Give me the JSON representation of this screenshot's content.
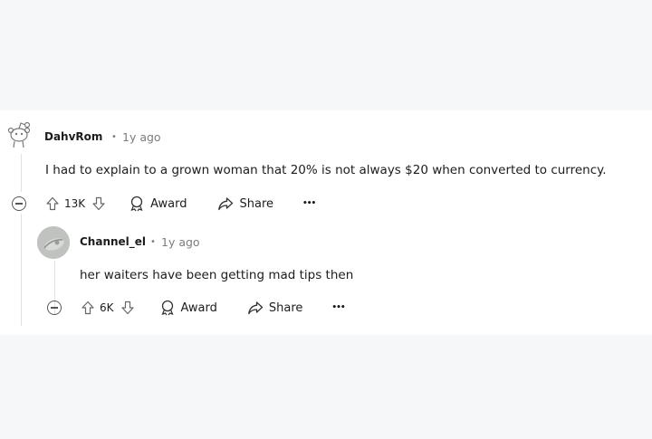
{
  "comment": {
    "username": "DahvRom",
    "separator": "•",
    "time": "1y ago",
    "text": "I had to explain to a grown woman that 20% is not always $20 when converted to currency.",
    "score": "13K",
    "award_label": "Award",
    "share_label": "Share",
    "more_label": "•••",
    "avatar_icon": "reddit-snoo-avatar-icon"
  },
  "reply": {
    "username": "Channel_el",
    "separator": "•",
    "time": "1y ago",
    "text": "her waiters have been getting mad tips then",
    "score": "6K",
    "award_label": "Award",
    "share_label": "Share",
    "more_label": "•••",
    "avatar_icon": "user-avatar-icon"
  }
}
